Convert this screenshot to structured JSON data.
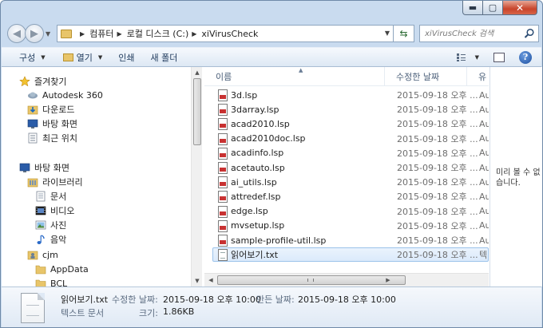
{
  "window": {
    "caption_buttons": {
      "minimize": "▬",
      "maximize": "▢",
      "close": "✕"
    }
  },
  "address_bar": {
    "breadcrumbs": [
      "컴퓨터",
      "로컬 디스크 (C:)",
      "xiVirusCheck"
    ],
    "search_placeholder": "xiVirusCheck 검색"
  },
  "toolbar": {
    "organize": "구성",
    "open": "열기",
    "print": "인쇄",
    "new_folder": "새 폴더",
    "help": "?"
  },
  "nav_pane": {
    "items": [
      {
        "label": "즐겨찾기",
        "icon": "star-icon"
      },
      {
        "label": "Autodesk 360",
        "icon": "cloud-icon"
      },
      {
        "label": "다운로드",
        "icon": "downloads-folder-icon"
      },
      {
        "label": "바탕 화면",
        "icon": "desktop-icon"
      },
      {
        "label": "최근 위치",
        "icon": "recent-places-icon"
      },
      {
        "label": "바탕 화면",
        "icon": "desktop-icon"
      },
      {
        "label": "라이브러리",
        "icon": "library-icon"
      },
      {
        "label": "문서",
        "icon": "documents-icon"
      },
      {
        "label": "비디오",
        "icon": "video-icon"
      },
      {
        "label": "사진",
        "icon": "pictures-icon"
      },
      {
        "label": "음악",
        "icon": "music-icon"
      },
      {
        "label": "cjm",
        "icon": "user-folder-icon"
      },
      {
        "label": "AppData",
        "icon": "folder-icon"
      },
      {
        "label": "BCL",
        "icon": "folder-icon"
      }
    ]
  },
  "file_list": {
    "columns": {
      "name": "이름",
      "date": "수정한 날짜",
      "type": "유"
    },
    "files": [
      {
        "name": "3d.lsp",
        "date": "2015-09-18 오후 ...",
        "type": "Au"
      },
      {
        "name": "3darray.lsp",
        "date": "2015-09-18 오후 ...",
        "type": "Au"
      },
      {
        "name": "acad2010.lsp",
        "date": "2015-09-18 오후 ...",
        "type": "Au"
      },
      {
        "name": "acad2010doc.lsp",
        "date": "2015-09-18 오후 ...",
        "type": "Au"
      },
      {
        "name": "acadinfo.lsp",
        "date": "2015-09-18 오후 ...",
        "type": "Au"
      },
      {
        "name": "acetauto.lsp",
        "date": "2015-09-18 오후 ...",
        "type": "Au"
      },
      {
        "name": "ai_utils.lsp",
        "date": "2015-09-18 오후 ...",
        "type": "Au"
      },
      {
        "name": "attredef.lsp",
        "date": "2015-09-18 오후 ...",
        "type": "Au"
      },
      {
        "name": "edge.lsp",
        "date": "2015-09-18 오후 ...",
        "type": "Au"
      },
      {
        "name": "mvsetup.lsp",
        "date": "2015-09-18 오후 ...",
        "type": "Au"
      },
      {
        "name": "sample-profile-util.lsp",
        "date": "2015-09-18 오후 ...",
        "type": "Au"
      },
      {
        "name": "읽어보기.txt",
        "date": "2015-09-18 오후 ...",
        "type": "텍"
      }
    ]
  },
  "preview": {
    "text": "미리 볼 수 없습니다."
  },
  "details": {
    "file_name": "읽어보기.txt",
    "modified_label": "수정한 날짜:",
    "modified_value": "2015-09-18 오후 10:00",
    "created_label": "만든 날짜:",
    "created_value": "2015-09-18 오후 10:00",
    "file_type": "텍스트 문서",
    "size_label": "크기:",
    "size_value": "1.86KB"
  }
}
